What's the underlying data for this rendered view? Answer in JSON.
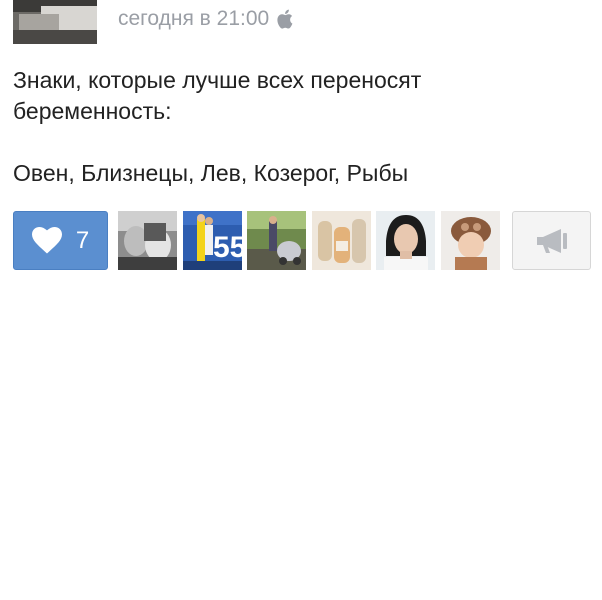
{
  "post": {
    "timestamp": "сегодня в 21:00",
    "platform_icon": "apple-icon",
    "text_lines": [
      "Знаки, которые лучше всех переносят",
      "беременность:",
      "Овен, Близнецы, Лев, Козерог, Рыбы"
    ]
  },
  "actions": {
    "like_count": "7",
    "like_icon": "heart-icon",
    "share_icon": "megaphone-icon"
  },
  "likers": [
    {
      "name": "liker-1"
    },
    {
      "name": "liker-2"
    },
    {
      "name": "liker-3"
    },
    {
      "name": "liker-4"
    },
    {
      "name": "liker-5"
    },
    {
      "name": "liker-6"
    }
  ],
  "colors": {
    "like_button": "#5b8fd0",
    "meta_text": "#9a9ea5",
    "body_text": "#222222"
  }
}
